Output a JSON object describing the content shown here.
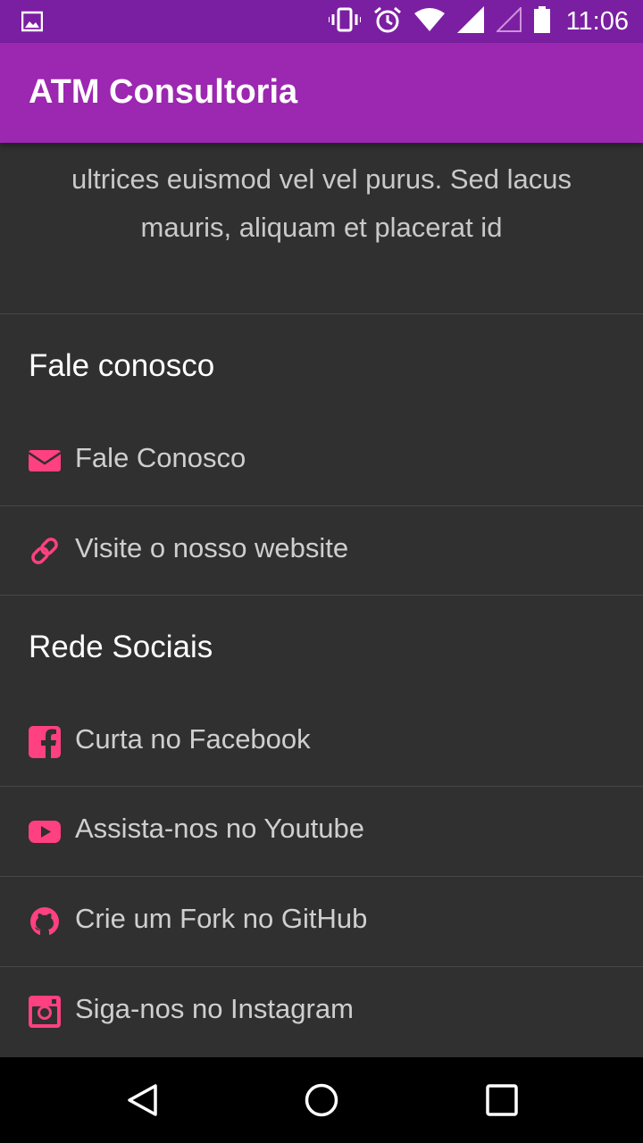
{
  "status_bar": {
    "time": "11:06",
    "icons": [
      "image-notification-icon",
      "vibrate-icon",
      "alarm-icon",
      "wifi-icon",
      "signal-icon",
      "signal-empty-icon",
      "battery-icon"
    ]
  },
  "app_bar": {
    "title": "ATM Consultoria"
  },
  "description": {
    "line1": "ultrices euismod vel vel purus. Sed lacus",
    "line2": "mauris, aliquam et placerat id"
  },
  "contact_section": {
    "title": "Fale conosco",
    "items": [
      {
        "label": "Fale Conosco",
        "icon": "envelope-icon"
      },
      {
        "label": "Visite o nosso website",
        "icon": "link-icon"
      }
    ]
  },
  "social_section": {
    "title": "Rede Sociais",
    "items": [
      {
        "label": "Curta no Facebook",
        "icon": "facebook-icon"
      },
      {
        "label": "Assista-nos no Youtube",
        "icon": "youtube-icon"
      },
      {
        "label": "Crie um Fork no GitHub",
        "icon": "github-icon"
      },
      {
        "label": "Siga-nos no Instagram",
        "icon": "instagram-icon"
      }
    ]
  },
  "colors": {
    "status_bar": "#7B1FA2",
    "app_bar": "#9C27B0",
    "background": "#303030",
    "accent_icon": "#FF4081"
  }
}
